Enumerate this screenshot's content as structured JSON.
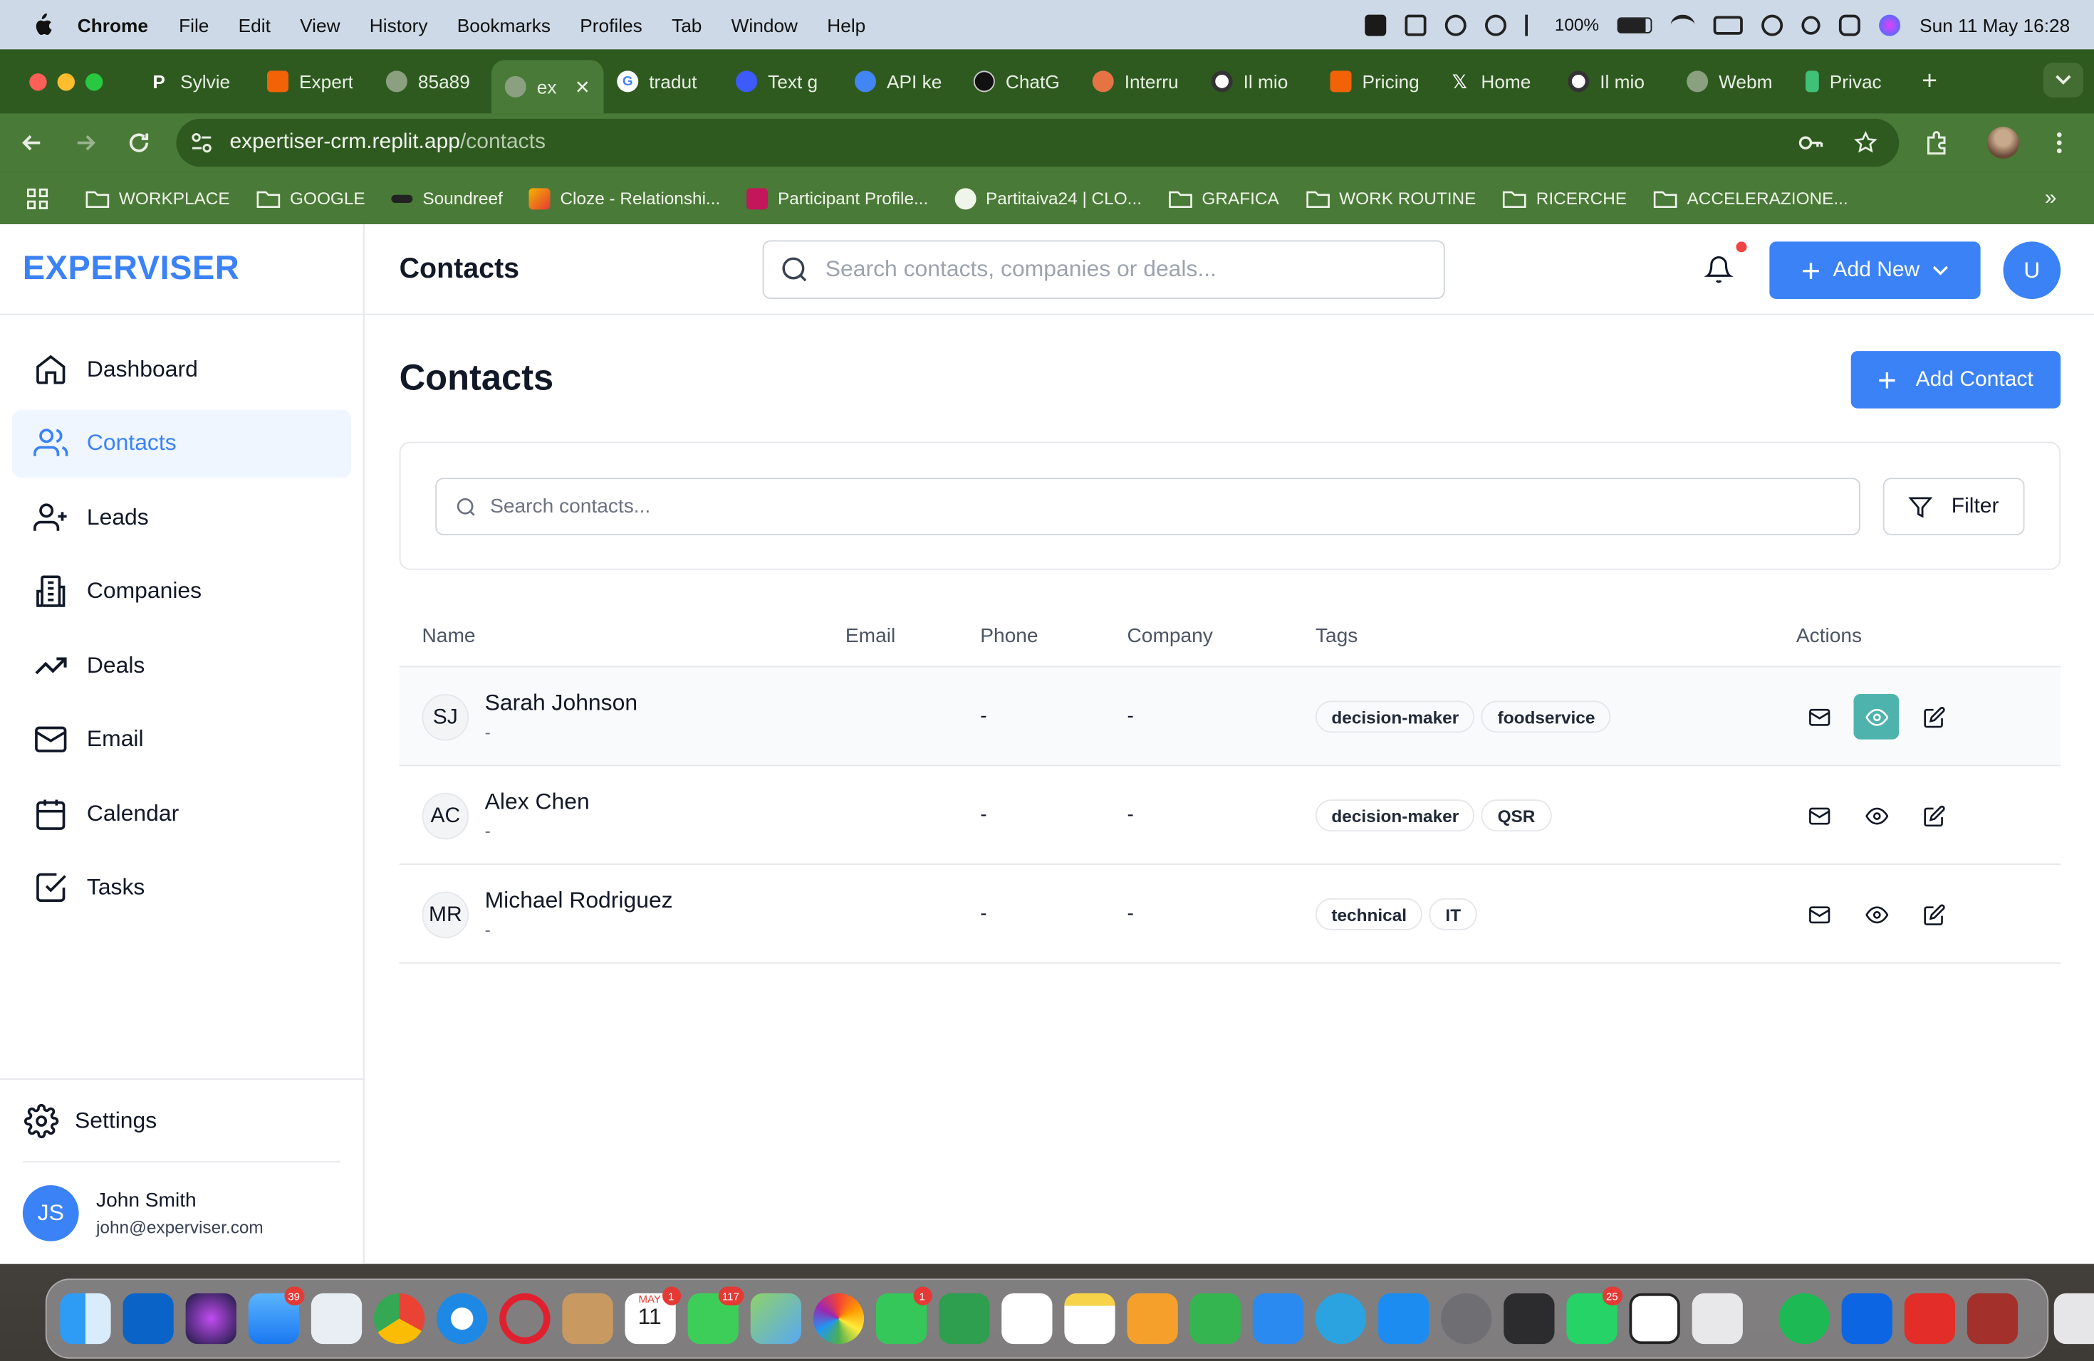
{
  "menubar": {
    "app_name": "Chrome",
    "items": [
      "File",
      "Edit",
      "View",
      "History",
      "Bookmarks",
      "Profiles",
      "Tab",
      "Window",
      "Help"
    ],
    "battery": "100%",
    "datetime": "Sun 11 May  16:28"
  },
  "browser": {
    "tabs": [
      {
        "label": "Sylvie",
        "icon": "P"
      },
      {
        "label": "Expert",
        "icon": "replit"
      },
      {
        "label": "85a89",
        "icon": "globe"
      },
      {
        "label": "ex",
        "icon": "globe",
        "active": true
      },
      {
        "label": "tradut",
        "icon": "G"
      },
      {
        "label": "Text g",
        "icon": "spiral"
      },
      {
        "label": "API ke",
        "icon": "spiral"
      },
      {
        "label": "ChatG",
        "icon": "openai"
      },
      {
        "label": "Interru",
        "icon": "circle"
      },
      {
        "label": "Il mio",
        "icon": "ring"
      },
      {
        "label": "Pricing",
        "icon": "replit"
      },
      {
        "label": "Home",
        "icon": "X"
      },
      {
        "label": "Il mio",
        "icon": "ring"
      },
      {
        "label": "Webm",
        "icon": "globe"
      },
      {
        "label": "Privac",
        "icon": "green"
      }
    ],
    "url_host": "expertiser-crm.replit.app",
    "url_path": "/contacts",
    "bookmarks": [
      {
        "label": "WORKPLACE",
        "icon": "folder"
      },
      {
        "label": "GOOGLE",
        "icon": "folder"
      },
      {
        "label": "Soundreef",
        "icon": "site"
      },
      {
        "label": "Cloze - Relationshi...",
        "icon": "site"
      },
      {
        "label": "Participant Profile...",
        "icon": "site"
      },
      {
        "label": "Partitaiva24 | CLO...",
        "icon": "site"
      },
      {
        "label": "GRAFICA",
        "icon": "folder"
      },
      {
        "label": "WORK ROUTINE",
        "icon": "folder"
      },
      {
        "label": "RICERCHE",
        "icon": "folder"
      },
      {
        "label": "ACCELERAZIONE...",
        "icon": "folder"
      }
    ],
    "bookmarks_more": "»"
  },
  "app": {
    "brand": "EXPERVISER",
    "nav": [
      {
        "label": "Dashboard",
        "icon": "home-icon"
      },
      {
        "label": "Contacts",
        "icon": "users-icon",
        "active": true
      },
      {
        "label": "Leads",
        "icon": "user-plus-icon"
      },
      {
        "label": "Companies",
        "icon": "building-icon"
      },
      {
        "label": "Deals",
        "icon": "trending-up-icon"
      },
      {
        "label": "Email",
        "icon": "mail-icon"
      },
      {
        "label": "Calendar",
        "icon": "calendar-icon"
      },
      {
        "label": "Tasks",
        "icon": "check-square-icon"
      }
    ],
    "settings_label": "Settings",
    "user": {
      "initials": "JS",
      "name": "John Smith",
      "email": "john@experviser.com"
    },
    "topbar": {
      "title": "Contacts",
      "search_placeholder": "Search contacts, companies or deals...",
      "add_new_label": "Add New",
      "user_initial": "U"
    },
    "page": {
      "title": "Contacts",
      "add_contact_label": "Add Contact",
      "search_placeholder": "Search contacts...",
      "filter_label": "Filter"
    },
    "table": {
      "columns": [
        "Name",
        "Email",
        "Phone",
        "Company",
        "Tags",
        "Actions"
      ],
      "rows": [
        {
          "initials": "SJ",
          "name": "Sarah Johnson",
          "sub": "-",
          "email": "",
          "phone": "-",
          "company": "-",
          "tags": [
            "decision-maker",
            "foodservice"
          ]
        },
        {
          "initials": "AC",
          "name": "Alex Chen",
          "sub": "-",
          "email": "",
          "phone": "-",
          "company": "-",
          "tags": [
            "decision-maker",
            "QSR"
          ]
        },
        {
          "initials": "MR",
          "name": "Michael Rodriguez",
          "sub": "-",
          "email": "",
          "phone": "-",
          "company": "-",
          "tags": [
            "technical",
            "IT"
          ]
        }
      ]
    }
  },
  "dock": {
    "badges": {
      "mail": "39",
      "calendar_date": "11",
      "calendar_month": "MAY",
      "calendar": "1",
      "messages": "117",
      "facetime": "1",
      "whatsapp": "25"
    }
  },
  "colors": {
    "accent": "#3b82f6",
    "active_nav_bg": "#eff6ff",
    "view_action": "#4eb3ad",
    "chrome_green": "#4a7a37",
    "chrome_tabbar": "#2e5a1f"
  }
}
